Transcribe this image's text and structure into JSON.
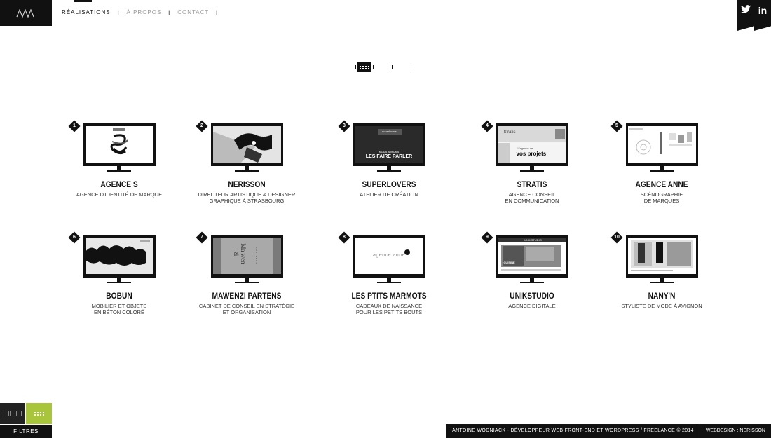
{
  "nav": {
    "items": [
      {
        "label": "Réalisations",
        "active": true
      },
      {
        "label": "À propos",
        "active": false
      },
      {
        "label": "Contact",
        "active": false
      }
    ]
  },
  "social": {
    "twitter_icon": "twitter-icon",
    "linkedin_icon": "linkedin-icon",
    "linkedin_label": "in"
  },
  "view_switch": {
    "options": [
      "grid",
      "list",
      "slider"
    ],
    "selected": "grid"
  },
  "projects": [
    {
      "num": "1",
      "title": "Agence S",
      "desc": "Agence d'identité de marque",
      "screen": "s"
    },
    {
      "num": "2",
      "title": "Nerisson",
      "desc": "Directeur artistique & designer\ngraphique à Strasbourg",
      "screen": "nerisson"
    },
    {
      "num": "3",
      "title": "Superlovers",
      "desc": "Atelier de création",
      "screen": "superlovers",
      "screen_texts": [
        "superlovers",
        "NOUS AIMONS",
        "LES FAIRE PARLER"
      ]
    },
    {
      "num": "4",
      "title": "Stratis",
      "desc": "Agence conseil\nen communication",
      "screen": "stratis",
      "screen_texts": [
        "Stratis",
        "L'agence de",
        "vos projets"
      ]
    },
    {
      "num": "5",
      "title": "Agence Anne",
      "desc": "Scénographie\nde marques",
      "screen": "anne"
    },
    {
      "num": "6",
      "title": "Bobun",
      "desc": "Mobilier et objets\nen béton coloré",
      "screen": "bobun"
    },
    {
      "num": "7",
      "title": "Mawenzi Partens",
      "desc": "Cabinet de conseil en stratégie\net organisation",
      "screen": "mawenzi",
      "screen_texts": [
        "Ma",
        "wen",
        "zi",
        "PARTNERS"
      ]
    },
    {
      "num": "8",
      "title": "Les Ptits Marmots",
      "desc": "Cadeaux de naissance\npour les petits bouts",
      "screen": "marmots",
      "screen_texts": [
        "agence anne"
      ]
    },
    {
      "num": "9",
      "title": "Unikstudio",
      "desc": "Agence digitale",
      "screen": "unik",
      "screen_texts": [
        "UNIKSTUDIO",
        "CUISINE"
      ]
    },
    {
      "num": "10",
      "title": "Nany'n",
      "desc": "Styliste de mode à Avignon",
      "screen": "nanyn"
    }
  ],
  "filters": {
    "label": "FILTRES"
  },
  "footer": {
    "credit": "Antoine Wodniack - Développeur web front-end et WordPress / Freelance © 2014",
    "design": "Webdesign : Nerisson"
  }
}
